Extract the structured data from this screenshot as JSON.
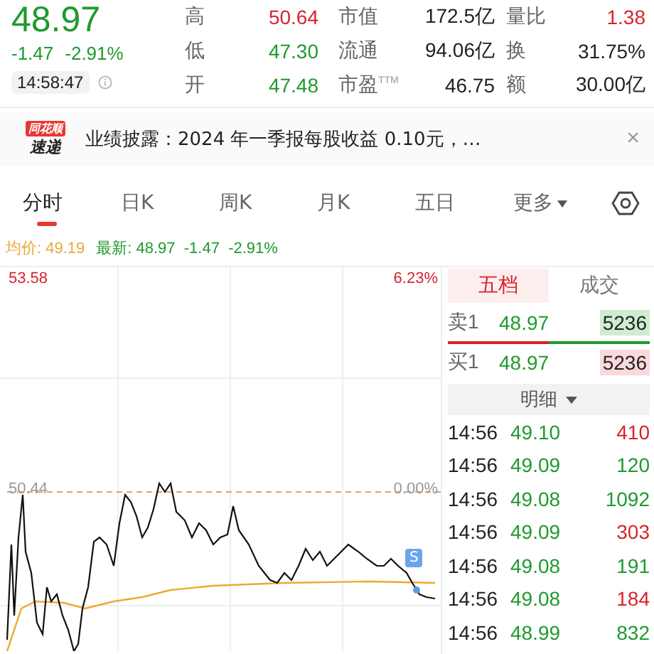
{
  "quote": {
    "price": "48.97",
    "change": "-1.47",
    "change_pct": "-2.91%",
    "time": "14:58:47",
    "color": "#1e9a2e"
  },
  "stats": [
    {
      "label": "高",
      "value": "50.64",
      "color": "#d8222d"
    },
    {
      "label": "市值",
      "value": "172.5亿",
      "color": "#222222"
    },
    {
      "label": "量比",
      "value": "1.38",
      "color": "#d8222d"
    },
    {
      "label": "低",
      "value": "47.30",
      "color": "#1e9a2e"
    },
    {
      "label": "流通",
      "value": "94.06亿",
      "color": "#222222"
    },
    {
      "label": "换",
      "value": "31.75%",
      "color": "#222222"
    },
    {
      "label": "开",
      "value": "47.48",
      "color": "#1e9a2e"
    },
    {
      "label": "市盈",
      "sup": "TTM",
      "value": "46.75",
      "color": "#222222"
    },
    {
      "label": "额",
      "value": "30.00亿",
      "color": "#222222"
    }
  ],
  "banner": {
    "logo_top": "同花顺",
    "logo_bottom": "速递",
    "text": "业绩披露：2024 年一季报每股收益 0.10元，…",
    "close": "×"
  },
  "tabs": [
    {
      "label": "分时",
      "selected": true,
      "dropdown": false
    },
    {
      "label": "日K",
      "selected": false,
      "dropdown": false
    },
    {
      "label": "周K",
      "selected": false,
      "dropdown": false
    },
    {
      "label": "月K",
      "selected": false,
      "dropdown": false
    },
    {
      "label": "五日",
      "selected": false,
      "dropdown": false
    },
    {
      "label": "更多",
      "selected": false,
      "dropdown": true
    }
  ],
  "legend": {
    "avg_label": "均价:",
    "avg": "49.19",
    "last_label": "最新:",
    "last": "48.97",
    "change": "-1.47",
    "change_pct": "-2.91%"
  },
  "chart": {
    "top_price": "53.58",
    "top_pct": "6.23%",
    "base_price": "50.44",
    "base_pct": "0.00%",
    "marker": "S"
  },
  "book": {
    "tabs": [
      {
        "label": "五档",
        "selected": true
      },
      {
        "label": "成交",
        "selected": false
      }
    ],
    "sell": {
      "label": "卖1",
      "price": "48.97",
      "volume": "5236"
    },
    "buy": {
      "label": "买1",
      "price": "48.97",
      "volume": "5236"
    },
    "detail": "明细",
    "trades": [
      {
        "time": "14:56",
        "price": "49.10",
        "volume": "410",
        "color": "#d8222d"
      },
      {
        "time": "14:56",
        "price": "49.09",
        "volume": "120",
        "color": "#1e9a2e"
      },
      {
        "time": "14:56",
        "price": "49.08",
        "volume": "1092",
        "color": "#1e9a2e"
      },
      {
        "time": "14:56",
        "price": "49.09",
        "volume": "303",
        "color": "#d8222d"
      },
      {
        "time": "14:56",
        "price": "49.08",
        "volume": "191",
        "color": "#1e9a2e"
      },
      {
        "time": "14:56",
        "price": "49.08",
        "volume": "184",
        "color": "#d8222d"
      },
      {
        "time": "14:56",
        "price": "48.99",
        "volume": "832",
        "color": "#1e9a2e"
      }
    ]
  }
}
